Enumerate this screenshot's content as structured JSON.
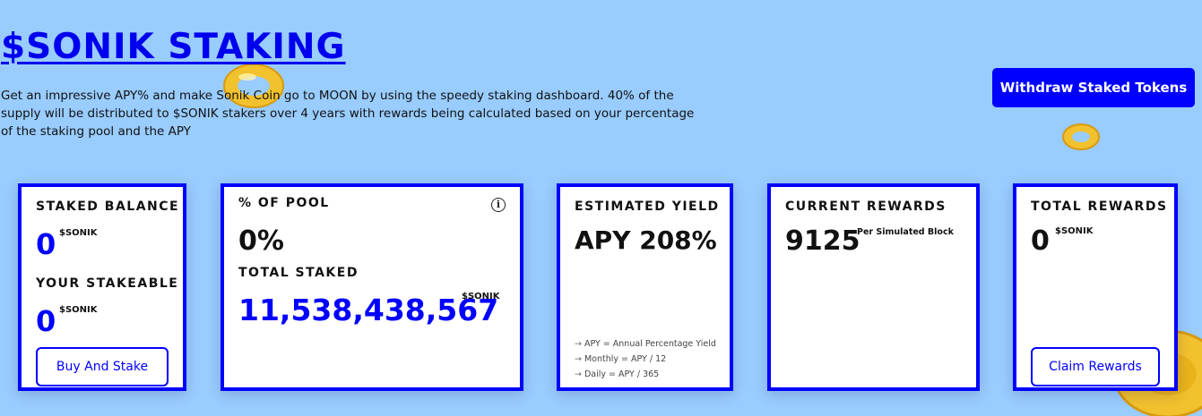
{
  "header": {
    "title": "$SONIK STAKING",
    "description": "Get an impressive APY% and make Sonik Coin go to MOON by using the speedy staking dashboard. 40% of the supply will be distributed to $SONIK stakers over 4 years with rewards being calculated based on your percentage of the staking pool and the APY",
    "withdraw_label": "Withdraw Staked Tokens"
  },
  "staked_card": {
    "staked_label": "STAKED BALANCE",
    "staked_value": "0",
    "staked_unit": "$SONIK",
    "stakeable_label": "YOUR STAKEABLE",
    "stakeable_value": "0",
    "stakeable_unit": "$SONIK",
    "button_label": "Buy And Stake"
  },
  "pool_card": {
    "pool_label": "% OF POOL",
    "pool_value": "0%",
    "total_label": "TOTAL STAKED",
    "total_value": "11,538,438,567",
    "total_unit": "$SONIK",
    "info_icon": "info-icon"
  },
  "yield_card": {
    "label": "ESTIMATED YIELD",
    "value": "APY 208%",
    "notes": [
      "APY = Annual Percentage Yield",
      "Monthly = APY / 12",
      "Daily = APY / 365"
    ],
    "note_arrow": "→"
  },
  "current_card": {
    "label": "CURRENT REWARDS",
    "value": "9125",
    "unit": "Per Simulated Block"
  },
  "total_card": {
    "label": "TOTAL REWARDS",
    "value": "0",
    "unit": "$SONIK",
    "button_label": "Claim Rewards"
  },
  "colors": {
    "background": "#99ccff",
    "accent": "#0000ff",
    "coin": "#f4c430"
  }
}
